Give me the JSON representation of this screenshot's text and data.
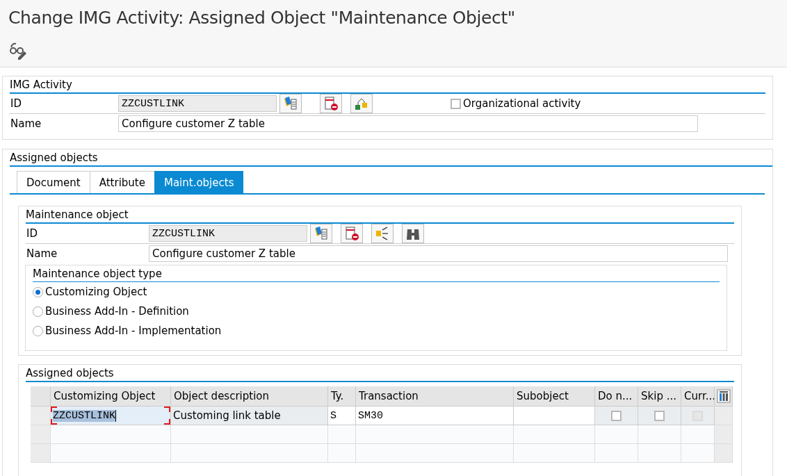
{
  "window": {
    "title": "Change IMG Activity: Assigned Object \"Maintenance Object\""
  },
  "img_activity": {
    "title": "IMG Activity",
    "id_label": "ID",
    "id_value": "ZZCUSTLINK",
    "name_label": "Name",
    "name_value": "Configure customer Z table",
    "organizational_activity": {
      "label": "Organizational activity",
      "checked": false
    }
  },
  "assigned_objects": {
    "title": "Assigned objects",
    "tabs": [
      {
        "label": "Document",
        "selected": false
      },
      {
        "label": "Attribute",
        "selected": false
      },
      {
        "label": "Maint.objects",
        "selected": true
      }
    ],
    "maintenance_object": {
      "title": "Maintenance object",
      "id_label": "ID",
      "id_value": "ZZCUSTLINK",
      "name_label": "Name",
      "name_value": "Configure customer Z table",
      "type_group": {
        "title": "Maintenance object type",
        "options": [
          {
            "label": "Customizing Object",
            "selected": true
          },
          {
            "label": "Business Add-In - Definition",
            "selected": false
          },
          {
            "label": "Business Add-In - Implementation",
            "selected": false
          }
        ]
      }
    },
    "table": {
      "title": "Assigned objects",
      "columns": [
        "Customizing Object",
        "Object description",
        "Ty.",
        "Transaction",
        "Subobject",
        "Do n...",
        "Skip ...",
        "Curr..."
      ],
      "rows": [
        {
          "object": "ZZCUSTLINK",
          "object_focused": true,
          "description": "Customing link table",
          "type": "S",
          "transaction": "SM30",
          "checks": [
            {
              "checked": false,
              "disabled": false
            },
            {
              "checked": false,
              "disabled": false
            },
            {
              "checked": false,
              "disabled": true
            }
          ]
        }
      ]
    }
  }
}
